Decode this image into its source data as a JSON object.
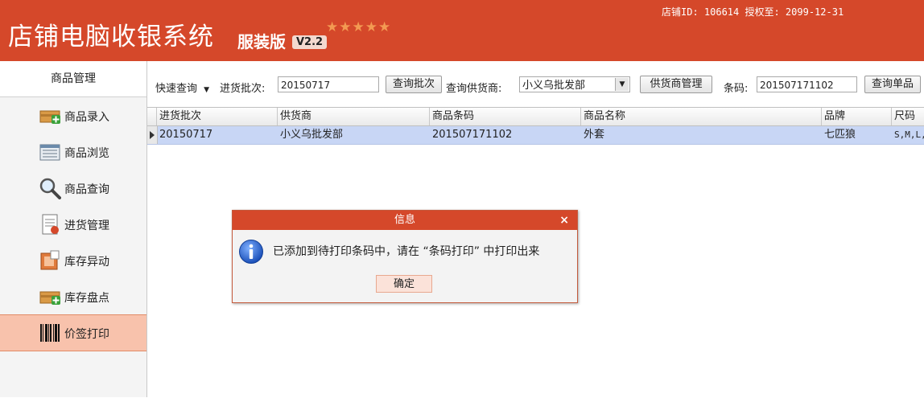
{
  "header": {
    "app_title": "店铺电脑收银系统",
    "edition": "服装版",
    "version": "V2.2",
    "stars": "★★★★★",
    "store_info": "店铺ID: 106614 授权至: 2099-12-31"
  },
  "sidebar": {
    "title": "商品管理",
    "items": [
      {
        "label": "商品录入",
        "icon": "product-add-icon"
      },
      {
        "label": "商品浏览",
        "icon": "product-list-icon"
      },
      {
        "label": "商品查询",
        "icon": "search-icon"
      },
      {
        "label": "进货管理",
        "icon": "purchase-doc-icon"
      },
      {
        "label": "库存异动",
        "icon": "stock-change-icon"
      },
      {
        "label": "库存盘点",
        "icon": "stock-count-icon"
      },
      {
        "label": "价签打印",
        "icon": "barcode-icon",
        "active": true
      }
    ]
  },
  "toolbar": {
    "quick_query": "快速查询",
    "batch_label": "进货批次:",
    "batch_value": "20150717",
    "query_batch_btn": "查询批次",
    "supplier_label": "查询供货商:",
    "supplier_value": "小义乌批发部",
    "supplier_mgmt_btn": "供货商管理",
    "barcode_label": "条码:",
    "barcode_value": "201507171102",
    "query_single_btn": "查询单品"
  },
  "grid": {
    "columns": [
      "进货批次",
      "供货商",
      "商品条码",
      "商品名称",
      "品牌",
      "尺码"
    ],
    "rows": [
      [
        "20150717",
        "小义乌批发部",
        "201507171102",
        "外套",
        "七匹狼",
        "S,M,L,"
      ]
    ]
  },
  "dialog": {
    "title": "信息",
    "close": "×",
    "message": "已添加到待打印条码中，请在 “条码打印” 中打印出来",
    "ok_button": "确定"
  },
  "colors": {
    "brand": "#d5482a",
    "active_sidebar": "#f8c2ac",
    "selected_row": "#c8d6f5"
  }
}
